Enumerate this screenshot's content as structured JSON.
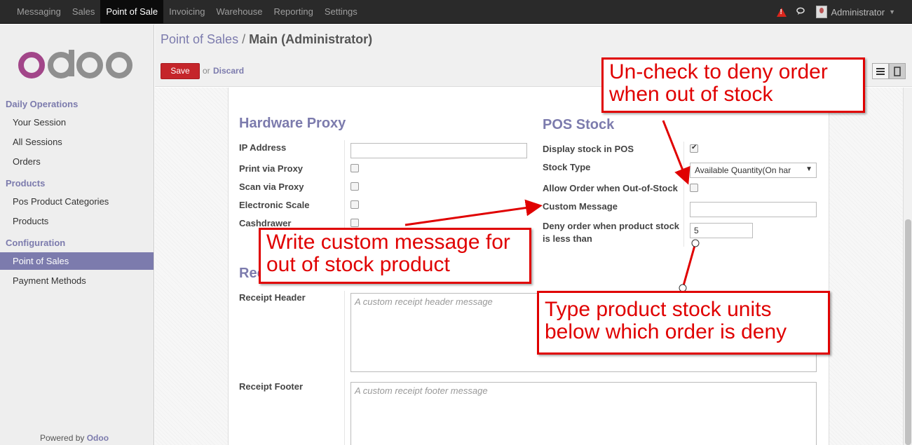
{
  "topbar": {
    "menu": [
      "Messaging",
      "Sales",
      "Point of Sale",
      "Invoicing",
      "Warehouse",
      "Reporting",
      "Settings"
    ],
    "user": "Administrator",
    "icons": [
      "alert-icon",
      "chat-icon",
      "avatar-icon"
    ]
  },
  "sidebar": {
    "logo_text": "odoo",
    "sections": [
      {
        "title": "Daily Operations",
        "items": [
          "Your Session",
          "All Sessions",
          "Orders"
        ]
      },
      {
        "title": "Products",
        "items": [
          "Pos Product Categories",
          "Products"
        ]
      },
      {
        "title": "Configuration",
        "items": [
          "Point of Sales",
          "Payment Methods"
        ]
      }
    ],
    "active_item": "Point of Sales",
    "powered_prefix": "Powered by",
    "powered_brand": "Odoo"
  },
  "header": {
    "breadcrumb_link": "Point of Sales",
    "breadcrumb_sep": "/",
    "breadcrumb_current": "Main (Administrator)",
    "save_label": "Save",
    "or_label": "or",
    "discard_label": "Discard"
  },
  "form": {
    "hardware": {
      "title": "Hardware Proxy",
      "ip_label": "IP Address",
      "ip_value": "",
      "print_label": "Print via Proxy",
      "scan_label": "Scan via Proxy",
      "scale_label": "Electronic Scale",
      "cash_label": "Cashdrawer"
    },
    "stock": {
      "title": "POS Stock",
      "display_label": "Display stock in POS",
      "display_checked": true,
      "type_label": "Stock Type",
      "type_value": "Available Quantity(On har",
      "allow_label": "Allow Order when Out-of-Stock",
      "allow_checked": false,
      "msg_label": "Custom Message",
      "msg_value": "",
      "deny_label_1": "Deny order when product stock",
      "deny_label_2": "is less than",
      "deny_value": "5"
    },
    "receipt": {
      "title": "Receipt",
      "header_label": "Receipt Header",
      "header_placeholder": "A custom receipt header message",
      "footer_label": "Receipt Footer",
      "footer_placeholder": "A custom receipt footer message"
    }
  },
  "annotations": {
    "uncheck_1": "Un-check to deny order",
    "uncheck_2": "when out of stock",
    "message_1": "Write custom message for",
    "message_2": "out of stock product",
    "units_1": "Type product stock units",
    "units_2": "below which order is deny"
  },
  "colors": {
    "accent": "#7c7bad",
    "save": "#c5252a",
    "annotation": "#e00000",
    "topbar": "#2a2a2a"
  }
}
